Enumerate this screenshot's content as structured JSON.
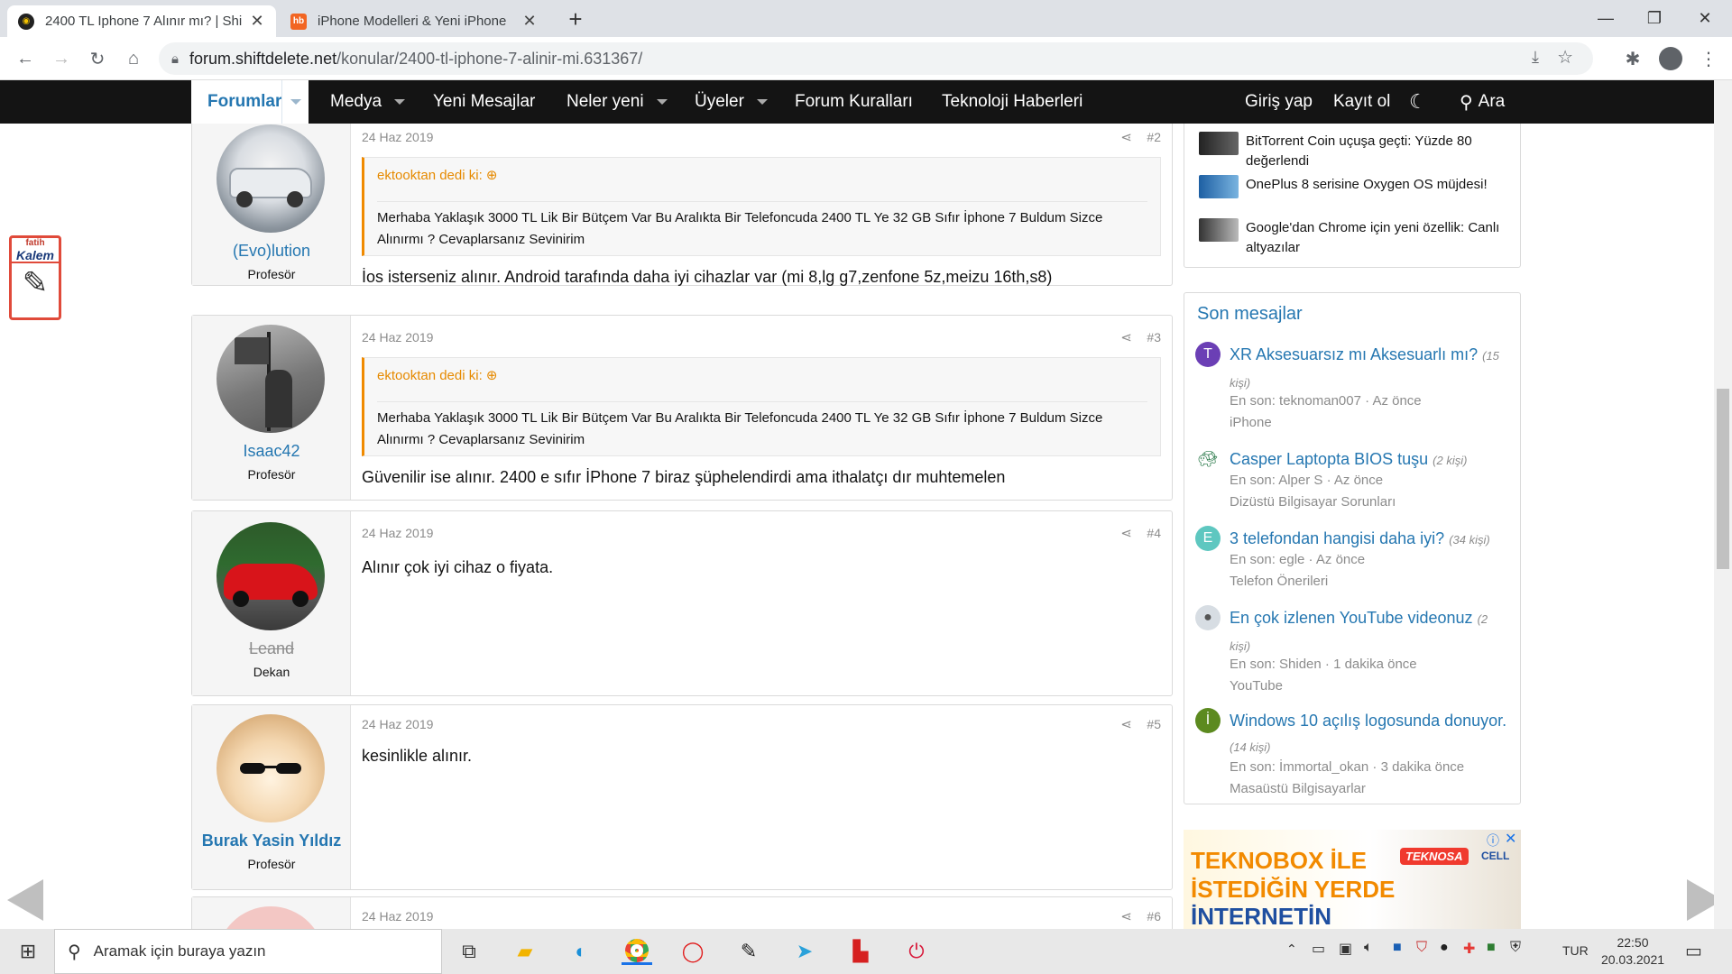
{
  "browser": {
    "tabs": [
      {
        "title": "2400 TL Iphone 7 Alınır mı? | Shif",
        "active": true
      },
      {
        "title": "iPhone Modelleri & Yeni iPhone",
        "active": false
      }
    ],
    "new_tab": "+",
    "url_host": "forum.shiftdelete.net",
    "url_path": "/konular/2400-tl-iphone-7-alinir-mi.631367/"
  },
  "forum_nav": {
    "items": [
      "Forumlar",
      "Medya",
      "Yeni Mesajlar",
      "Neler yeni",
      "Üyeler",
      "Forum Kuralları",
      "Teknoloji Haberleri"
    ],
    "login": "Giriş yap",
    "register": "Kayıt ol",
    "search": "Ara"
  },
  "fatih_kalem": {
    "line1": "fatih",
    "line2": "Kalem"
  },
  "posts": [
    {
      "user": "(Evo)lution",
      "rank": "Profesör",
      "date": "24 Haz 2019",
      "num": "#2",
      "quote_author": "ektooktan dedi ki:",
      "quote_text": "Merhaba Yaklaşık 3000 TL Lik Bir Bütçem Var Bu Aralıkta Bir Telefoncuda 2400 TL Ye 32 GB Sıfır İphone 7 Buldum Sizce Alınırmı ? Cevaplarsanız Sevinirim",
      "body": "İos isterseniz alınır. Android tarafında daha iyi cihazlar var (mi 8,lg g7,zenfone 5z,meizu 16th,s8)"
    },
    {
      "user": "Isaac42",
      "rank": "Profesör",
      "date": "24 Haz 2019",
      "num": "#3",
      "quote_author": "ektooktan dedi ki:",
      "quote_text": "Merhaba Yaklaşık 3000 TL Lik Bir Bütçem Var Bu Aralıkta Bir Telefoncuda 2400 TL Ye 32 GB Sıfır İphone 7 Buldum Sizce Alınırmı ? Cevaplarsanız Sevinirim",
      "body": "Güvenilir ise alınır. 2400 e sıfır İPhone 7 biraz şüphelendirdi ama ithalatçı dır muhtemelen"
    },
    {
      "user": "Leand",
      "rank": "Dekan",
      "date": "24 Haz 2019",
      "num": "#4",
      "body": "Alınır çok iyi cihaz o fiyata."
    },
    {
      "user": "Burak Yasin Yıldız",
      "rank": "Profesör",
      "date": "24 Haz 2019",
      "num": "#5",
      "body": "kesinlikle alınır."
    },
    {
      "date": "24 Haz 2019",
      "num": "#6"
    }
  ],
  "news": [
    {
      "title": "BitTorrent Coin uçuşa geçti: Yüzde 80 değerlendi"
    },
    {
      "title": "OnePlus 8 serisine Oxygen OS müjdesi!"
    },
    {
      "title": "Google'dan Chrome için yeni özellik: Canlı altyazılar"
    }
  ],
  "recent": {
    "title": "Son mesajlar",
    "items": [
      {
        "avatar": "T",
        "color": "#6b3fb5",
        "title": "XR Aksesuarsız mı Aksesuarlı mı?",
        "count": "(15 kişi)",
        "meta": "En son: teknoman007 · Az önce",
        "forum": "iPhone"
      },
      {
        "avatar": "",
        "color": "#4a8a6a",
        "title": "Casper Laptopta BIOS tuşu",
        "count": "(2 kişi)",
        "meta": "En son: Alper S · Az önce",
        "forum": "Dizüstü Bilgisayar Sorunları"
      },
      {
        "avatar": "E",
        "color": "#5ec7c0",
        "title": "3 telefondan hangisi daha iyi?",
        "count": "(34 kişi)",
        "meta": "En son: egle · Az önce",
        "forum": "Telefon Önerileri"
      },
      {
        "avatar": "",
        "color": "#9aa5b1",
        "title": "En çok izlenen YouTube videonuz",
        "count": "(2 kişi)",
        "meta": "En son: Shiden · 1 dakika önce",
        "forum": "YouTube"
      },
      {
        "avatar": "İ",
        "color": "#5c8a1f",
        "title": "Windows 10 açılış logosunda donuyor.",
        "count": "(14 kişi)",
        "meta": "En son: İmmortal_okan · 3 dakika önce",
        "forum": "Masaüstü Bilgisayarlar"
      }
    ]
  },
  "ad": {
    "line1": "TEKNOBOX İLE",
    "line2": "İSTEDİĞİN YERDE",
    "line3": "İNTERNETİN",
    "brand": "TEKNOSA",
    "brand2": "CELL"
  },
  "taskbar": {
    "search_placeholder": "Aramak için buraya yazın",
    "lang": "TUR",
    "time": "22:50",
    "date": "20.03.2021"
  },
  "colors": {
    "nav_bg": "#141414",
    "link": "#2577b1",
    "quote": "#e68a00"
  }
}
